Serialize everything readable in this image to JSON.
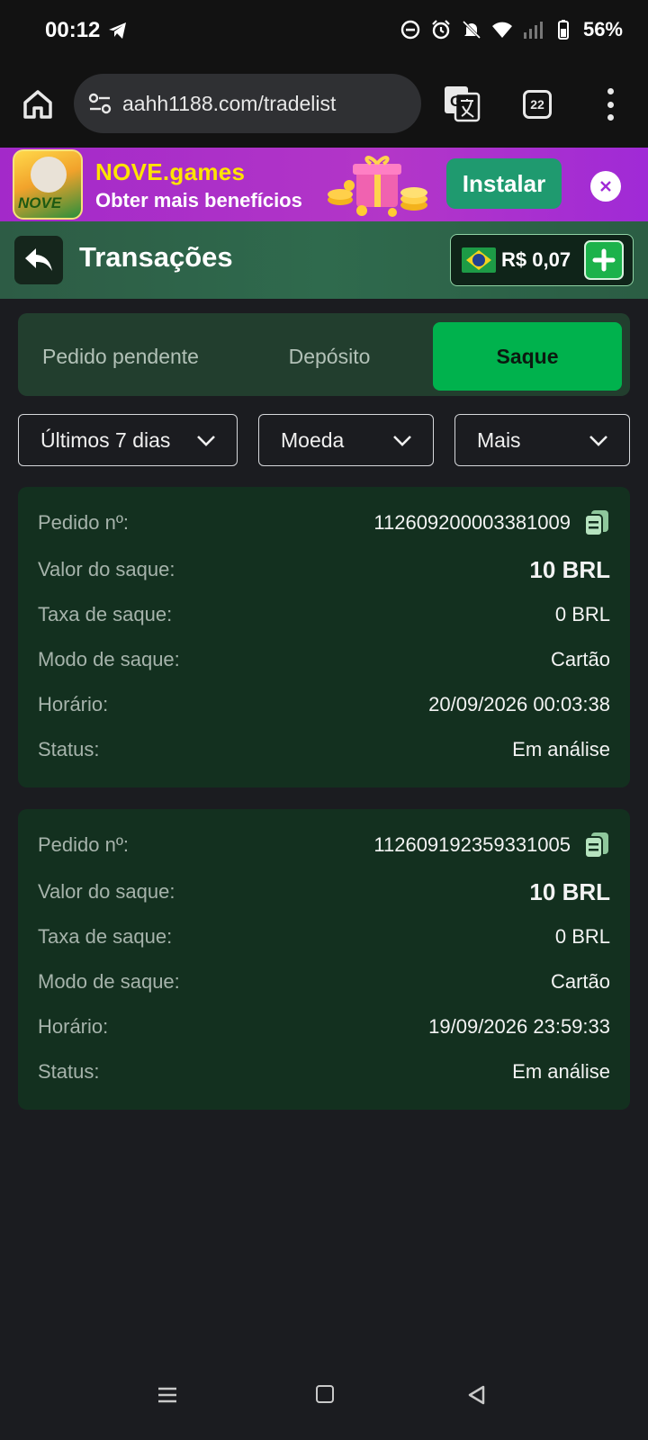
{
  "status_bar": {
    "time": "00:12",
    "battery": "56%"
  },
  "browser": {
    "url": "aahh1188.com/tradelist",
    "tab_count": "22"
  },
  "promo": {
    "logo_text": "NOVE",
    "title": "NOVE.games",
    "subtitle": "Obter mais benefícios",
    "install_label": "Instalar"
  },
  "header": {
    "title": "Transações",
    "balance": "R$ 0,07"
  },
  "tabs": [
    {
      "label": "Pedido pendente",
      "active": false
    },
    {
      "label": "Depósito",
      "active": false
    },
    {
      "label": "Saque",
      "active": true
    }
  ],
  "filters": {
    "period": "Últimos 7 dias",
    "currency": "Moeda",
    "more": "Mais"
  },
  "labels": {
    "order_no": "Pedido nº:",
    "amount": "Valor do saque:",
    "fee": "Taxa de saque:",
    "mode": "Modo de saque:",
    "time": "Horário:",
    "status": "Status:"
  },
  "transactions": [
    {
      "order_no": "112609200003381009",
      "amount": "10 BRL",
      "fee": "0 BRL",
      "mode": "Cartão",
      "time": "20/09/2026 00:03:38",
      "status": "Em análise"
    },
    {
      "order_no": "112609192359331005",
      "amount": "10 BRL",
      "fee": "0 BRL",
      "mode": "Cartão",
      "time": "19/09/2026 23:59:33",
      "status": "Em análise"
    }
  ],
  "colors": {
    "accent_green": "#00b24d",
    "card_bg": "#13301f",
    "promo_title": "#ffe400"
  }
}
